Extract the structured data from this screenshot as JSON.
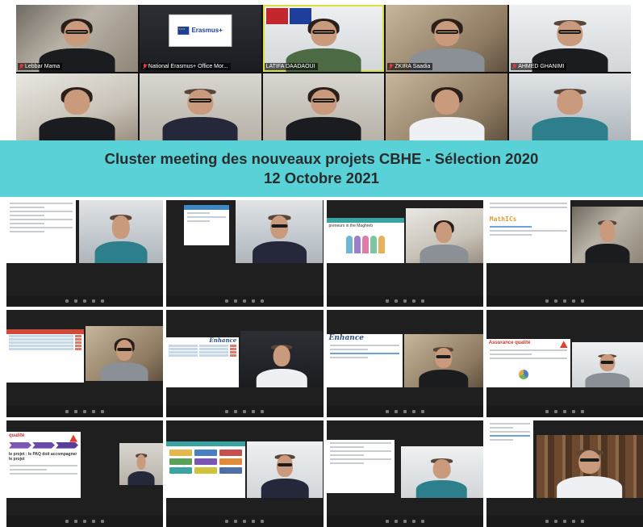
{
  "participants_top": [
    {
      "name": "Lebbar Mama",
      "muted": true
    },
    {
      "name": "National Erasmus+ Office Mor...",
      "muted": true
    },
    {
      "name": "LATIFA DAADAOUI",
      "muted": false,
      "active": true
    },
    {
      "name": "ZKIRA Saadia",
      "muted": true
    },
    {
      "name": "AHMED GHANIMI",
      "muted": true
    },
    {
      "name": "",
      "muted": false
    },
    {
      "name": "",
      "muted": false
    },
    {
      "name": "",
      "muted": false
    },
    {
      "name": "",
      "muted": false
    },
    {
      "name": "",
      "muted": false
    }
  ],
  "erasmus_logo": {
    "text": "Erasmus+"
  },
  "banner": {
    "line1": "Cluster meeting des nouveaux projets CBHE - Sélection 2020",
    "line2": "12 Octobre 2021"
  },
  "slides": {
    "maghreb": "preneurs in the Maghreb",
    "mathics": "MathICs",
    "enhance": "Enhance",
    "qualite": "Assurance qualité",
    "qualite2": "qualité",
    "paq_line": "le projet : le PAQ doit accompagner le projet"
  },
  "colors": {
    "banner": "#58d1d7",
    "banner_text": "#2b2b2b",
    "active_speaker": "#d8e23a",
    "muted_icon": "#e03a3a"
  }
}
